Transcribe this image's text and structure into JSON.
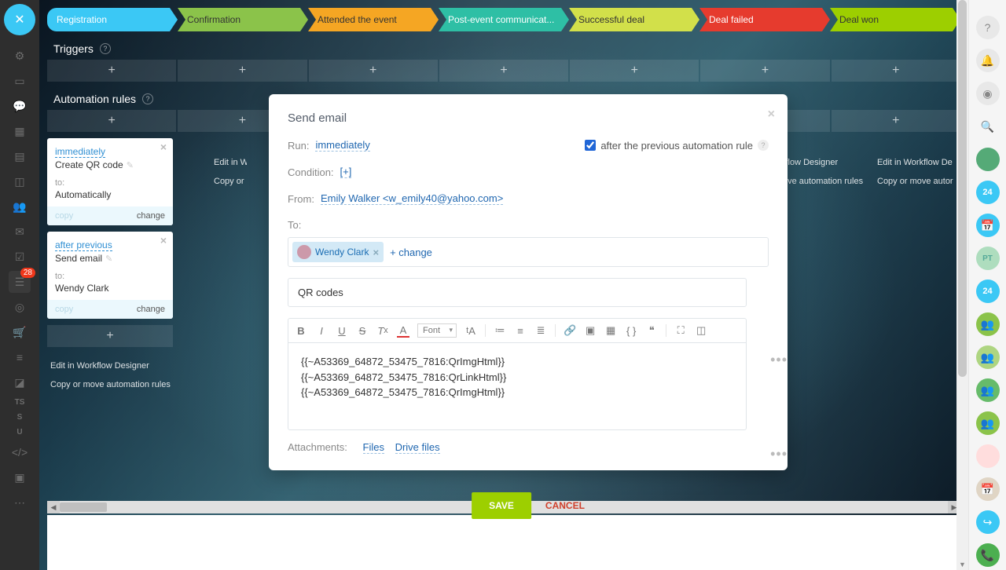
{
  "stages": [
    {
      "label": "Registration",
      "color": "#3bc8f5"
    },
    {
      "label": "Confirmation",
      "color": "#8bc34a"
    },
    {
      "label": "Attended the event",
      "color": "#f5a623"
    },
    {
      "label": "Post-event communicat...",
      "color": "#2ebfa5"
    },
    {
      "label": "Successful deal",
      "color": "#d2e04a"
    },
    {
      "label": "Deal failed",
      "color": "#e63b2e"
    },
    {
      "label": "Deal won",
      "color": "#9dcf00"
    }
  ],
  "sections": {
    "triggers": "Triggers",
    "rules": "Automation rules"
  },
  "cards": [
    {
      "run": "immediately",
      "action": "Create QR code",
      "to_label": "to:",
      "to_value": "Automatically",
      "copy": "copy",
      "change": "change"
    },
    {
      "run": "after previous",
      "action": "Send email",
      "to_label": "to:",
      "to_value": "Wendy Clark",
      "copy": "copy",
      "change": "change"
    }
  ],
  "rule_links": {
    "edit": "Edit in Workflow Designer",
    "copymove": "Copy or move automation rules"
  },
  "partial_links": {
    "edit": "Edit in W",
    "copymove": "Copy or",
    "edit2": "Workflow Designer",
    "copymove2": "or move automation rules",
    "edit3": "Edit in Workflow De",
    "copymove3": "Copy or move autor"
  },
  "modal": {
    "title": "Send email",
    "run_label": "Run:",
    "run_value": "immediately",
    "after_prev": "after the previous automation rule",
    "condition_label": "Condition:",
    "condition_value": "[+]",
    "from_label": "From:",
    "from_value": "Emily Walker <w_emily40@yahoo.com>",
    "to_label": "To:",
    "to_chip": "Wendy Clark",
    "change": "+ change",
    "subject": "QR codes",
    "body_lines": [
      "{{~A53369_64872_53475_7816:QrImgHtml}}",
      "{{~A53369_64872_53475_7816:QrLinkHtml}}",
      "{{~A53369_64872_53475_7816:QrImgHtml}}"
    ],
    "attach_label": "Attachments:",
    "attach_files": "Files",
    "attach_drive": "Drive files",
    "save": "SAVE",
    "cancel": "CANCEL",
    "font": "Font"
  },
  "left_rail_badge": "28",
  "left_rail_text": [
    "TS",
    "S",
    "U"
  ],
  "right_rail": {
    "num": "24",
    "pt": "PT"
  }
}
